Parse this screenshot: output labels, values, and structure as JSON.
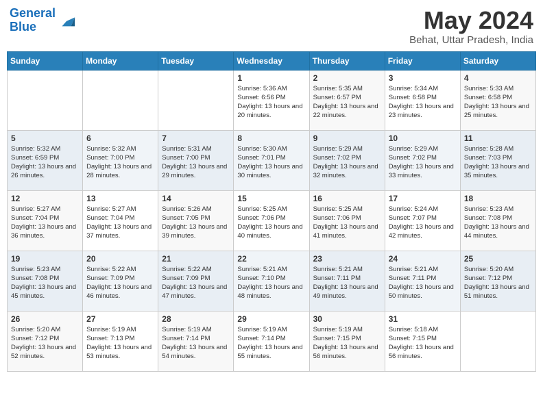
{
  "header": {
    "logo_line1": "General",
    "logo_line2": "Blue",
    "month_year": "May 2024",
    "location": "Behat, Uttar Pradesh, India"
  },
  "days_of_week": [
    "Sunday",
    "Monday",
    "Tuesday",
    "Wednesday",
    "Thursday",
    "Friday",
    "Saturday"
  ],
  "weeks": [
    [
      {
        "num": "",
        "sunrise": "",
        "sunset": "",
        "daylight": ""
      },
      {
        "num": "",
        "sunrise": "",
        "sunset": "",
        "daylight": ""
      },
      {
        "num": "",
        "sunrise": "",
        "sunset": "",
        "daylight": ""
      },
      {
        "num": "1",
        "sunrise": "5:36 AM",
        "sunset": "6:56 PM",
        "daylight": "13 hours and 20 minutes."
      },
      {
        "num": "2",
        "sunrise": "5:35 AM",
        "sunset": "6:57 PM",
        "daylight": "13 hours and 22 minutes."
      },
      {
        "num": "3",
        "sunrise": "5:34 AM",
        "sunset": "6:58 PM",
        "daylight": "13 hours and 23 minutes."
      },
      {
        "num": "4",
        "sunrise": "5:33 AM",
        "sunset": "6:58 PM",
        "daylight": "13 hours and 25 minutes."
      }
    ],
    [
      {
        "num": "5",
        "sunrise": "5:32 AM",
        "sunset": "6:59 PM",
        "daylight": "13 hours and 26 minutes."
      },
      {
        "num": "6",
        "sunrise": "5:32 AM",
        "sunset": "7:00 PM",
        "daylight": "13 hours and 28 minutes."
      },
      {
        "num": "7",
        "sunrise": "5:31 AM",
        "sunset": "7:00 PM",
        "daylight": "13 hours and 29 minutes."
      },
      {
        "num": "8",
        "sunrise": "5:30 AM",
        "sunset": "7:01 PM",
        "daylight": "13 hours and 30 minutes."
      },
      {
        "num": "9",
        "sunrise": "5:29 AM",
        "sunset": "7:02 PM",
        "daylight": "13 hours and 32 minutes."
      },
      {
        "num": "10",
        "sunrise": "5:29 AM",
        "sunset": "7:02 PM",
        "daylight": "13 hours and 33 minutes."
      },
      {
        "num": "11",
        "sunrise": "5:28 AM",
        "sunset": "7:03 PM",
        "daylight": "13 hours and 35 minutes."
      }
    ],
    [
      {
        "num": "12",
        "sunrise": "5:27 AM",
        "sunset": "7:04 PM",
        "daylight": "13 hours and 36 minutes."
      },
      {
        "num": "13",
        "sunrise": "5:27 AM",
        "sunset": "7:04 PM",
        "daylight": "13 hours and 37 minutes."
      },
      {
        "num": "14",
        "sunrise": "5:26 AM",
        "sunset": "7:05 PM",
        "daylight": "13 hours and 39 minutes."
      },
      {
        "num": "15",
        "sunrise": "5:25 AM",
        "sunset": "7:06 PM",
        "daylight": "13 hours and 40 minutes."
      },
      {
        "num": "16",
        "sunrise": "5:25 AM",
        "sunset": "7:06 PM",
        "daylight": "13 hours and 41 minutes."
      },
      {
        "num": "17",
        "sunrise": "5:24 AM",
        "sunset": "7:07 PM",
        "daylight": "13 hours and 42 minutes."
      },
      {
        "num": "18",
        "sunrise": "5:23 AM",
        "sunset": "7:08 PM",
        "daylight": "13 hours and 44 minutes."
      }
    ],
    [
      {
        "num": "19",
        "sunrise": "5:23 AM",
        "sunset": "7:08 PM",
        "daylight": "13 hours and 45 minutes."
      },
      {
        "num": "20",
        "sunrise": "5:22 AM",
        "sunset": "7:09 PM",
        "daylight": "13 hours and 46 minutes."
      },
      {
        "num": "21",
        "sunrise": "5:22 AM",
        "sunset": "7:09 PM",
        "daylight": "13 hours and 47 minutes."
      },
      {
        "num": "22",
        "sunrise": "5:21 AM",
        "sunset": "7:10 PM",
        "daylight": "13 hours and 48 minutes."
      },
      {
        "num": "23",
        "sunrise": "5:21 AM",
        "sunset": "7:11 PM",
        "daylight": "13 hours and 49 minutes."
      },
      {
        "num": "24",
        "sunrise": "5:21 AM",
        "sunset": "7:11 PM",
        "daylight": "13 hours and 50 minutes."
      },
      {
        "num": "25",
        "sunrise": "5:20 AM",
        "sunset": "7:12 PM",
        "daylight": "13 hours and 51 minutes."
      }
    ],
    [
      {
        "num": "26",
        "sunrise": "5:20 AM",
        "sunset": "7:12 PM",
        "daylight": "13 hours and 52 minutes."
      },
      {
        "num": "27",
        "sunrise": "5:19 AM",
        "sunset": "7:13 PM",
        "daylight": "13 hours and 53 minutes."
      },
      {
        "num": "28",
        "sunrise": "5:19 AM",
        "sunset": "7:14 PM",
        "daylight": "13 hours and 54 minutes."
      },
      {
        "num": "29",
        "sunrise": "5:19 AM",
        "sunset": "7:14 PM",
        "daylight": "13 hours and 55 minutes."
      },
      {
        "num": "30",
        "sunrise": "5:19 AM",
        "sunset": "7:15 PM",
        "daylight": "13 hours and 56 minutes."
      },
      {
        "num": "31",
        "sunrise": "5:18 AM",
        "sunset": "7:15 PM",
        "daylight": "13 hours and 56 minutes."
      },
      {
        "num": "",
        "sunrise": "",
        "sunset": "",
        "daylight": ""
      }
    ]
  ],
  "labels": {
    "sunrise": "Sunrise:",
    "sunset": "Sunset:",
    "daylight": "Daylight:"
  }
}
